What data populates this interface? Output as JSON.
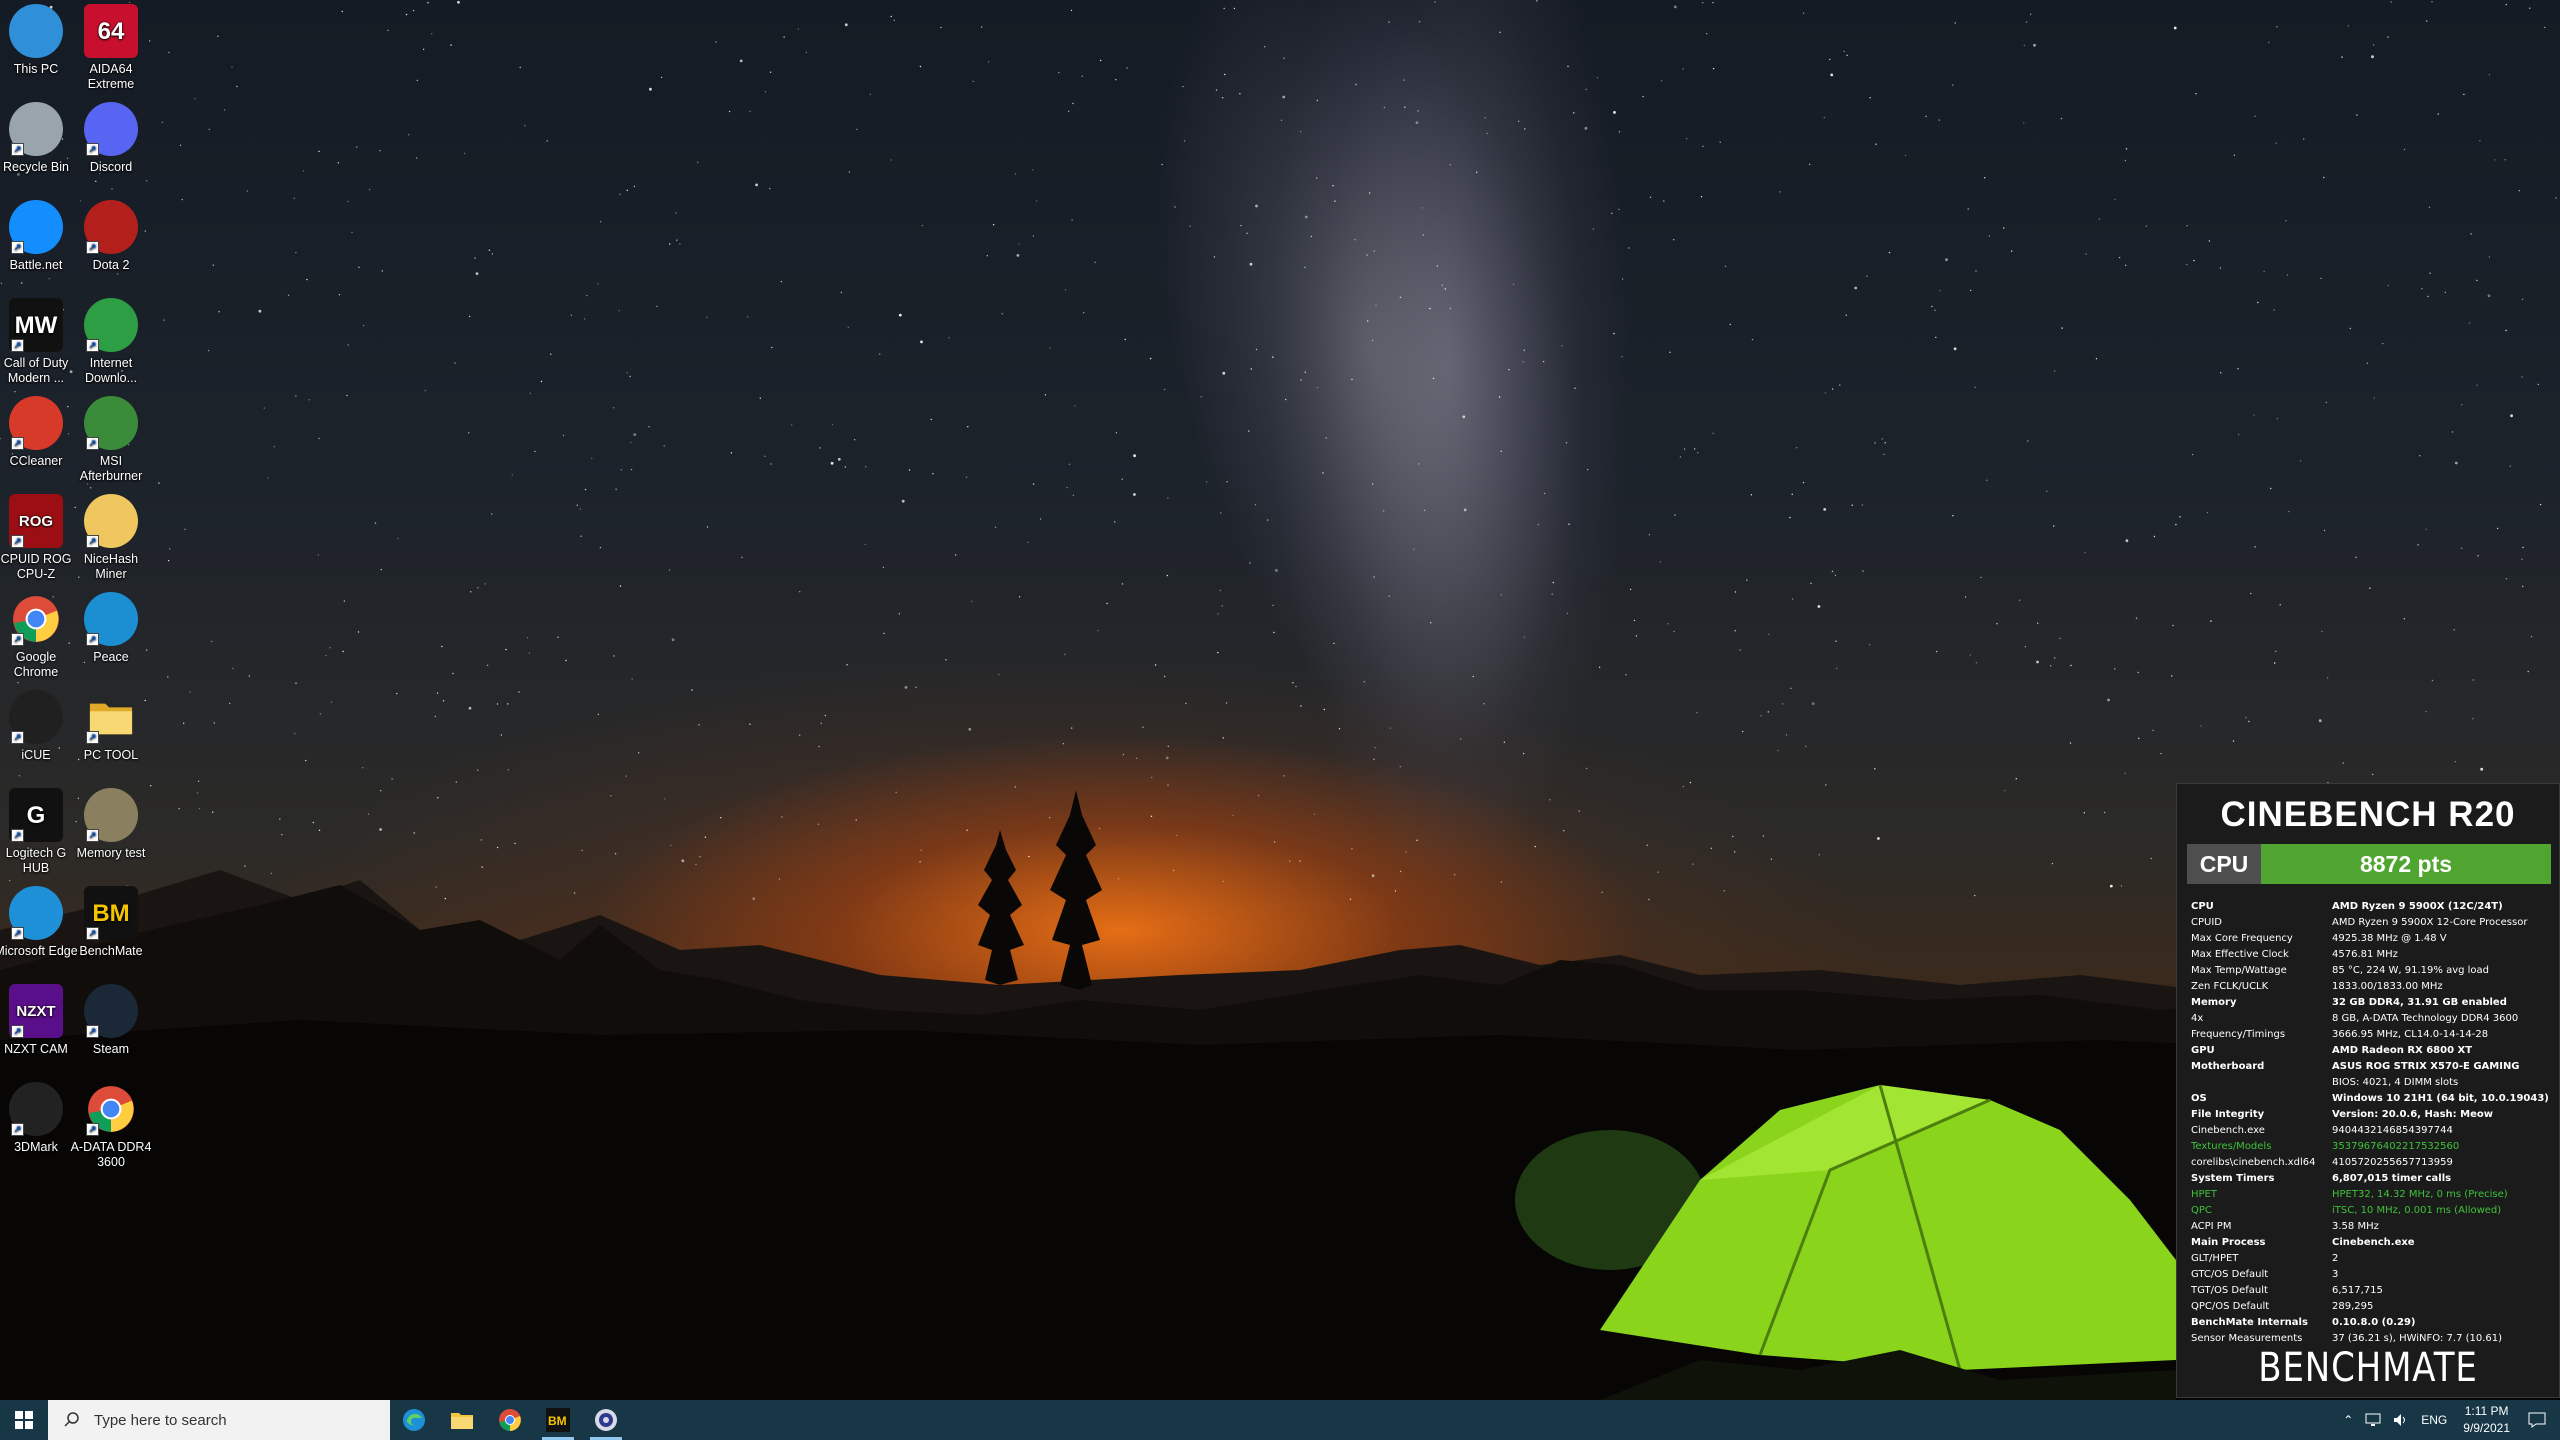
{
  "desktop": {
    "icons": [
      {
        "label": "This PC",
        "icon": "this-pc-icon"
      },
      {
        "label": "AIDA64 Extreme",
        "icon": "aida64-icon",
        "glyph": "64"
      },
      {
        "label": "Recycle Bin",
        "icon": "recycle-bin-icon"
      },
      {
        "label": "Discord",
        "icon": "discord-icon"
      },
      {
        "label": "Battle.net",
        "icon": "battlenet-icon"
      },
      {
        "label": "Dota 2",
        "icon": "dota2-icon"
      },
      {
        "label": "Call of Duty Modern ...",
        "icon": "call-of-duty-icon",
        "glyph": "MW"
      },
      {
        "label": "Internet Downlo...",
        "icon": "internet-download-manager-icon"
      },
      {
        "label": "CCleaner",
        "icon": "ccleaner-icon"
      },
      {
        "label": "MSI Afterburner",
        "icon": "msi-afterburner-icon"
      },
      {
        "label": "CPUID ROG CPU-Z",
        "icon": "cpu-z-icon",
        "glyph": "ROG"
      },
      {
        "label": "NiceHash Miner",
        "icon": "nicehash-icon"
      },
      {
        "label": "Google Chrome",
        "icon": "chrome-icon"
      },
      {
        "label": "Peace",
        "icon": "peace-icon"
      },
      {
        "label": "iCUE",
        "icon": "icue-icon"
      },
      {
        "label": "PC TOOL",
        "icon": "folder-icon"
      },
      {
        "label": "Logitech G HUB",
        "icon": "logitech-ghub-icon",
        "glyph": "G"
      },
      {
        "label": "Memory test",
        "icon": "memory-test-icon"
      },
      {
        "label": "Microsoft Edge",
        "icon": "edge-icon"
      },
      {
        "label": "BenchMate",
        "icon": "benchmate-icon",
        "glyph": "BM"
      },
      {
        "label": "NZXT CAM",
        "icon": "nzxt-cam-icon",
        "glyph": "NZXT"
      },
      {
        "label": "Steam",
        "icon": "steam-icon"
      },
      {
        "label": "3DMark",
        "icon": "3dmark-icon"
      },
      {
        "label": "A-DATA DDR4 3600",
        "icon": "chrome-icon"
      }
    ]
  },
  "benchmate": {
    "title": "CINEBENCH R20",
    "score_label": "CPU",
    "score_value": "8872 pts",
    "logo": "BENCHMATE",
    "rows": [
      {
        "k": "CPU",
        "v": "AMD Ryzen 9 5900X (12C/24T)",
        "style": "bold"
      },
      {
        "k": "CPUID",
        "v": "AMD Ryzen 9 5900X 12-Core Processor",
        "style": ""
      },
      {
        "k": "Max Core Frequency",
        "v": "4925.38 MHz @ 1.48 V",
        "style": ""
      },
      {
        "k": "Max Effective Clock",
        "v": "4576.81 MHz",
        "style": ""
      },
      {
        "k": "Max Temp/Wattage",
        "v": "85 °C, 224 W, 91.19% avg load",
        "style": ""
      },
      {
        "k": "Zen FCLK/UCLK",
        "v": "1833.00/1833.00 MHz",
        "style": ""
      },
      {
        "k": "Memory",
        "v": "32 GB DDR4, 31.91 GB enabled",
        "style": "bold"
      },
      {
        "k": "4x",
        "v": "8 GB, A-DATA Technology DDR4 3600",
        "style": ""
      },
      {
        "k": "Frequency/Timings",
        "v": "3666.95 MHz, CL14.0-14-14-28",
        "style": ""
      },
      {
        "k": "GPU",
        "v": "AMD Radeon RX 6800 XT",
        "style": "bold"
      },
      {
        "k": "Motherboard",
        "v": "ASUS ROG STRIX X570-E GAMING",
        "style": "bold"
      },
      {
        "k": "",
        "v": "BIOS: 4021, 4 DIMM slots",
        "style": ""
      },
      {
        "k": "OS",
        "v": "Windows 10 21H1 (64 bit, 10.0.19043)",
        "style": "bold"
      },
      {
        "k": "File Integrity",
        "v": "Version: 20.0.6, Hash: Meow",
        "style": "bold"
      },
      {
        "k": "Cinebench.exe",
        "v": "9404432146854397744",
        "style": ""
      },
      {
        "k": "Textures/Models",
        "v": "3537967640221753256​0",
        "style": "green"
      },
      {
        "k": "corelibs\\cinebench.xdl64",
        "v": "4105720255657713959",
        "style": ""
      },
      {
        "k": "System Timers",
        "v": "6,807,015 timer calls",
        "style": "bold"
      },
      {
        "k": "HPET",
        "v": "HPET32, 14.32 MHz, 0 ms (Precise)",
        "style": "green"
      },
      {
        "k": "QPC",
        "v": "iTSC, 10 MHz, 0.001 ms (Allowed)",
        "style": "green"
      },
      {
        "k": "ACPI PM",
        "v": "3.58 MHz",
        "style": ""
      },
      {
        "k": "Main Process",
        "v": "Cinebench.exe",
        "style": "bold"
      },
      {
        "k": "GLT/HPET",
        "v": "2",
        "style": ""
      },
      {
        "k": "GTC/OS Default",
        "v": "3",
        "style": ""
      },
      {
        "k": "TGT/OS Default",
        "v": "6,517,715",
        "style": ""
      },
      {
        "k": "QPC/OS Default",
        "v": "289,295",
        "style": ""
      },
      {
        "k": "BenchMate Internals",
        "v": "0.10.8.0 (0.29)",
        "style": "bold"
      },
      {
        "k": "Sensor Measurements",
        "v": "37 (36.21 s), HWiNFO: 7.7 (10.61)",
        "style": ""
      }
    ]
  },
  "taskbar": {
    "search_placeholder": "Type here to search",
    "apps": [
      {
        "name": "edge-taskbar-icon",
        "active": false
      },
      {
        "name": "file-explorer-taskbar-icon",
        "active": false
      },
      {
        "name": "chrome-taskbar-icon",
        "active": false
      },
      {
        "name": "benchmate-taskbar-icon",
        "active": true
      },
      {
        "name": "cinebench-taskbar-icon",
        "active": true
      }
    ],
    "language": "ENG",
    "time": "1:11 PM",
    "date": "9/9/2021"
  }
}
